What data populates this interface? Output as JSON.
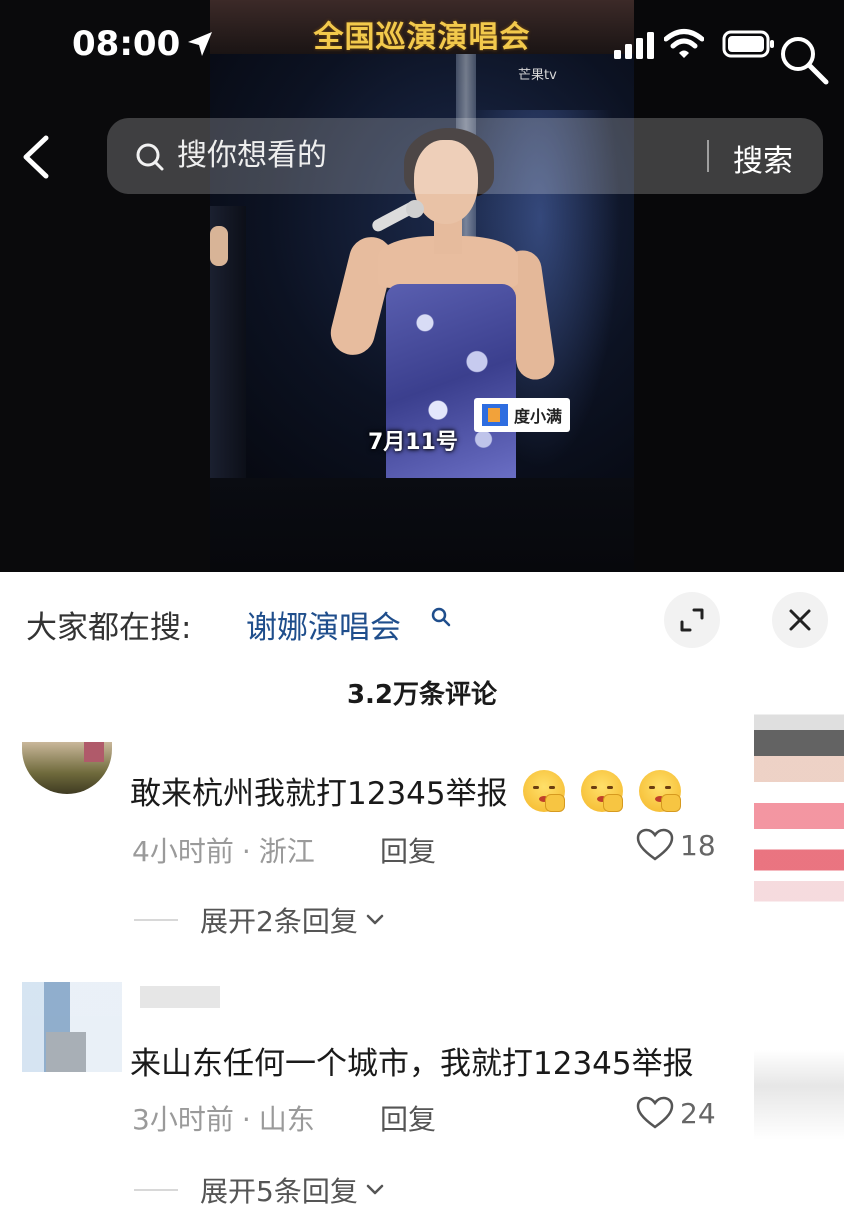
{
  "status_bar": {
    "time": "08:00"
  },
  "video": {
    "banner_text": "全国巡演演唱会",
    "channel_logo": "芒果tv",
    "date_caption": "7月11号",
    "watermark_text": "度小满"
  },
  "search": {
    "placeholder": "搜你想看的",
    "button_label": "搜索"
  },
  "comments_panel": {
    "trending_label": "大家都在搜:",
    "trending_query": "谢娜演唱会",
    "comment_count_label": "3.2万条评论",
    "comments": [
      {
        "text": "敢来杭州我就打12345举报",
        "emoji_count": 3,
        "time": "4小时前",
        "location": "浙江",
        "reply_label": "回复",
        "likes": "18",
        "expand_label": "展开2条回复"
      },
      {
        "text": "来山东任何一个城市，我就打12345举报",
        "time": "3小时前",
        "location": "山东",
        "reply_label": "回复",
        "likes": "24",
        "expand_label": "展开5条回复"
      }
    ]
  },
  "colors": {
    "link": "#1f4e8c",
    "banner_text": "#f2c94c",
    "meta": "#9a9a9a"
  }
}
